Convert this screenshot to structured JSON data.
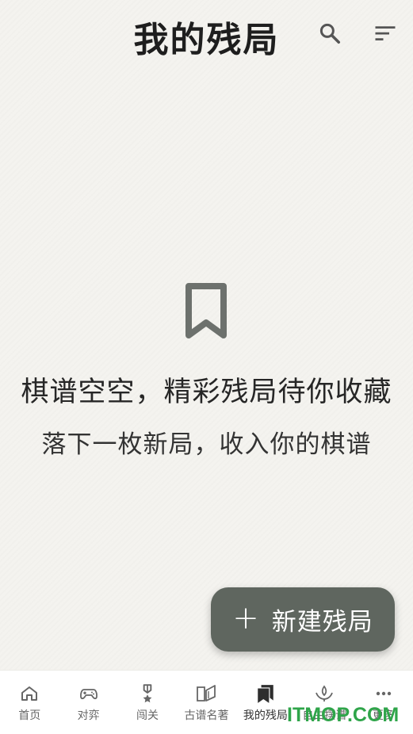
{
  "header": {
    "title": "我的残局",
    "search_icon": "search-icon",
    "sort_icon": "sort-icon"
  },
  "empty_state": {
    "icon": "bookmark-icon",
    "title": "棋谱空空，精彩残局待你收藏",
    "subtitle": "落下一枚新局，收入你的棋谱"
  },
  "fab": {
    "icon": "plus-icon",
    "label": "新建残局",
    "color": "#5f665f"
  },
  "bottom_nav": {
    "items": [
      {
        "label": "首页",
        "icon": "home-icon"
      },
      {
        "label": "对弈",
        "icon": "gamepad-icon"
      },
      {
        "label": "闯关",
        "icon": "medal-icon"
      },
      {
        "label": "古谱名著",
        "icon": "book-icon"
      },
      {
        "label": "我的残局",
        "icon": "bookmark-icon",
        "active": true
      },
      {
        "label": "自由摆谱",
        "icon": "lotus-icon"
      },
      {
        "label": "更多",
        "icon": "more-icon"
      }
    ]
  },
  "watermark": {
    "text": "ITMOP.COM",
    "color": "#2fa54a"
  }
}
